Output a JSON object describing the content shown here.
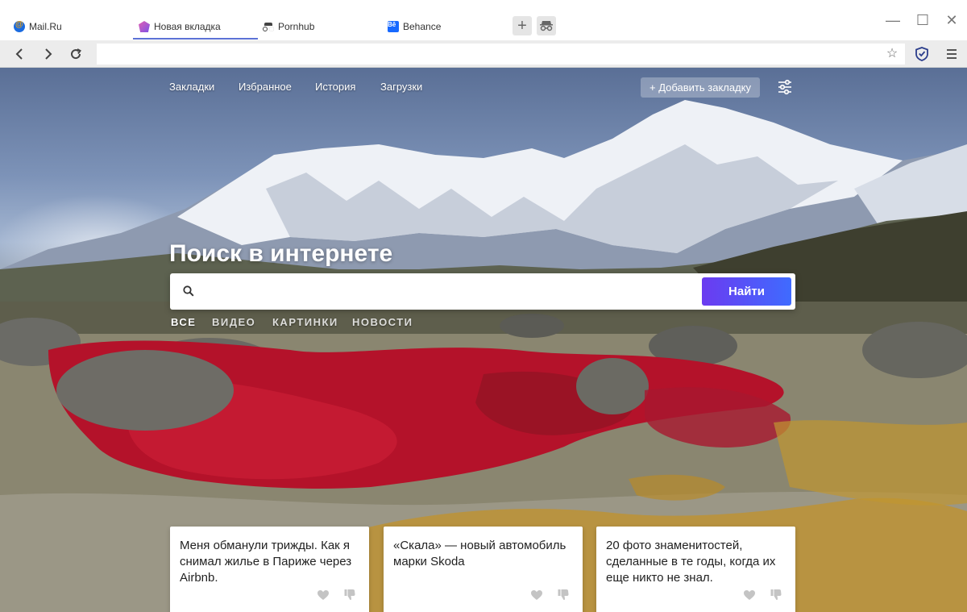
{
  "browser": {
    "tabs": [
      {
        "label": "Mail.Ru",
        "icon": "mailru-icon"
      },
      {
        "label": "Новая вкладка",
        "icon": "new-tab-icon",
        "active": true
      },
      {
        "label": "Pornhub",
        "icon": "incognito-icon"
      },
      {
        "label": "Behance",
        "icon": "behance-icon"
      }
    ],
    "new_tab_glyph": "+",
    "behance_mark": "Bē",
    "window_controls": {
      "minimize": "—",
      "maximize": "☐",
      "close": "✕"
    },
    "nav": {
      "back": "‹",
      "forward": "›",
      "reload": "↻"
    },
    "address": {
      "value": "",
      "placeholder": ""
    },
    "bookmark_star": "☆"
  },
  "page": {
    "top_nav": [
      "Закладки",
      "Избранное",
      "История",
      "Загрузки"
    ],
    "add_bookmark_label": "+ Добавить закладку",
    "search": {
      "title": "Поиск в интернете",
      "placeholder": "",
      "button_label": "Найти",
      "tabs": [
        "ВСЕ",
        "ВИДЕО",
        "КАРТИНКИ",
        "НОВОСТИ"
      ],
      "active_tab": "ВСЕ"
    },
    "cards": [
      {
        "title": "Меня обманули трижды. Как я снимал жилье в Париже через Airbnb."
      },
      {
        "title": "«Скала» — новый автомобиль марки Skoda"
      },
      {
        "title": "20 фото знаменитостей, сделанные в те годы, когда их еще никто не знал."
      }
    ]
  },
  "colors": {
    "accent": "#5c72d6",
    "search_button_start": "#6b3bf0",
    "search_button_end": "#3f6bff"
  }
}
